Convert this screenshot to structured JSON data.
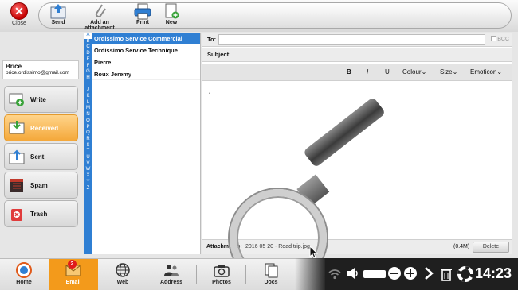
{
  "toolbar": {
    "close_label": "Close",
    "send_label": "Send",
    "attach_label": "Add an attachment",
    "print_label": "Print",
    "new_label": "New"
  },
  "user": {
    "name": "Brice",
    "email": "brice.ordissimo@gmail.com"
  },
  "folders": [
    {
      "label": "Write",
      "icon": "write-icon",
      "active": false
    },
    {
      "label": "Received",
      "icon": "inbox-icon",
      "active": true
    },
    {
      "label": "Sent",
      "icon": "sent-icon",
      "active": false
    },
    {
      "label": "Spam",
      "icon": "spam-icon",
      "active": false
    },
    {
      "label": "Trash",
      "icon": "trash-icon",
      "active": false
    }
  ],
  "alphabet": [
    "A",
    "B",
    "C",
    "D",
    "E",
    "F",
    "G",
    "H",
    "I",
    "J",
    "K",
    "L",
    "M",
    "N",
    "O",
    "P",
    "Q",
    "R",
    "S",
    "T",
    "U",
    "V",
    "W",
    "X",
    "Y",
    "Z"
  ],
  "contacts": [
    {
      "name": "Ordissimo Service Commercial",
      "selected": true
    },
    {
      "name": "Ordissimo Service Technique",
      "selected": false
    },
    {
      "name": "Pierre",
      "selected": false
    },
    {
      "name": "Roux Jeremy",
      "selected": false
    }
  ],
  "compose": {
    "to_label": "To:",
    "to_value": "",
    "bcc_label": "BCC",
    "subject_label": "Subject:",
    "subject_value": "",
    "format": {
      "bold": "B",
      "italic": "I",
      "underline": "U",
      "colour": "Colour",
      "size": "Size",
      "emoticon": "Emoticon"
    },
    "body_text": ".",
    "attachment_label": "Attachments:",
    "attachment_file": "2016 05 20 - Road trip.jpg",
    "attachment_size": "(0.4M)",
    "delete_label": "Delete"
  },
  "taskbar": {
    "items": [
      {
        "label": "Home",
        "icon": "home-icon",
        "active": false
      },
      {
        "label": "Email",
        "icon": "email-icon",
        "active": true,
        "badge": "2"
      },
      {
        "label": "Web",
        "icon": "globe-icon",
        "active": false
      },
      {
        "label": "Address",
        "icon": "address-book-icon",
        "active": false
      },
      {
        "label": "Photos",
        "icon": "camera-icon",
        "active": false
      },
      {
        "label": "Docs",
        "icon": "docs-icon",
        "active": false
      }
    ],
    "clock": "14:23"
  },
  "colors": {
    "accent_blue": "#2f7fd3",
    "active_orange": "#f39a1b",
    "close_red": "#c40000"
  }
}
